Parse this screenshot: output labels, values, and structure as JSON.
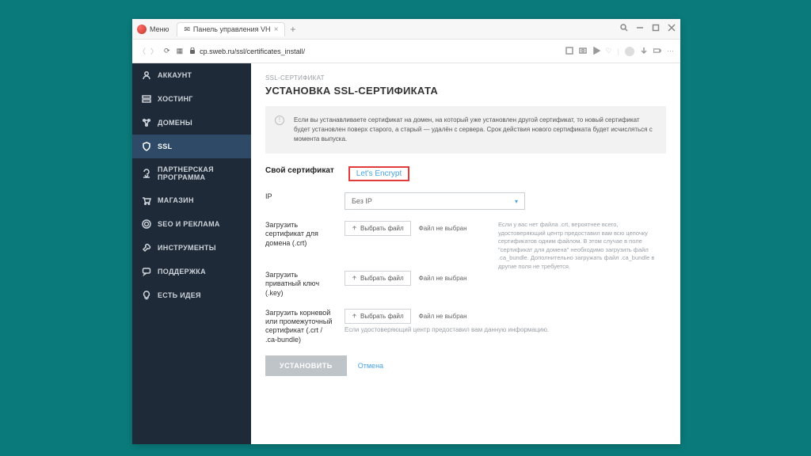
{
  "browser": {
    "menu": "Меню",
    "tab_title": "Панель управления VH",
    "url": "cp.sweb.ru/ssl/certificates_install/"
  },
  "sidebar": {
    "items": [
      {
        "label": "АККАУНТ"
      },
      {
        "label": "ХОСТИНГ"
      },
      {
        "label": "ДОМЕНЫ"
      },
      {
        "label": "SSL"
      },
      {
        "label": "ПАРТНЕРСКАЯ ПРОГРАММА"
      },
      {
        "label": "МАГАЗИН"
      },
      {
        "label": "SEO И РЕКЛАМА"
      },
      {
        "label": "ИНСТРУМЕНТЫ"
      },
      {
        "label": "ПОДДЕРЖКА"
      },
      {
        "label": "ЕСТЬ ИДЕЯ"
      }
    ]
  },
  "page": {
    "breadcrumb": "SSL-СЕРТИФИКАТ",
    "title": "УСТАНОВКА SSL-СЕРТИФИКАТА",
    "info": "Если вы устанавливаете сертификат на домен, на который уже установлен другой сертификат, то новый сертификат будет установлен поверх старого, а старый — удалён с сервера. Срок действия нового сертификата будет исчисляться с момента выпуска.",
    "tabs": {
      "own": "Свой сертификат",
      "le": "Let's Encrypt"
    },
    "ip_label": "IP",
    "ip_value": "Без IP",
    "crt": {
      "label": "Загрузить сертификат для домена (.crt)",
      "btn": "Выбрать файл",
      "status": "Файл не выбран"
    },
    "crt_note": "Если у вас нет файла .crt, вероятнее всего, удостоверяющий центр предоставил вам всю цепочку сертификатов одним файлом. В этом случае в поле \"сертификат для домена\" необходимо загрузить файл .ca_bundle. Дополнительно загружать файл .ca_bundle в другие поля не требуется.",
    "key": {
      "label": "Загрузить приватный ключ (.key)",
      "btn": "Выбрать файл",
      "status": "Файл не выбран"
    },
    "bundle": {
      "label": "Загрузить корневой или промежуточный сертификат (.crt / .ca-bundle)",
      "btn": "Выбрать файл",
      "status": "Файл не выбран",
      "note": "Если удостоверяющий центр предоставил вам данную информацию."
    },
    "install": "УСТАНОВИТЬ",
    "cancel": "Отмена"
  }
}
